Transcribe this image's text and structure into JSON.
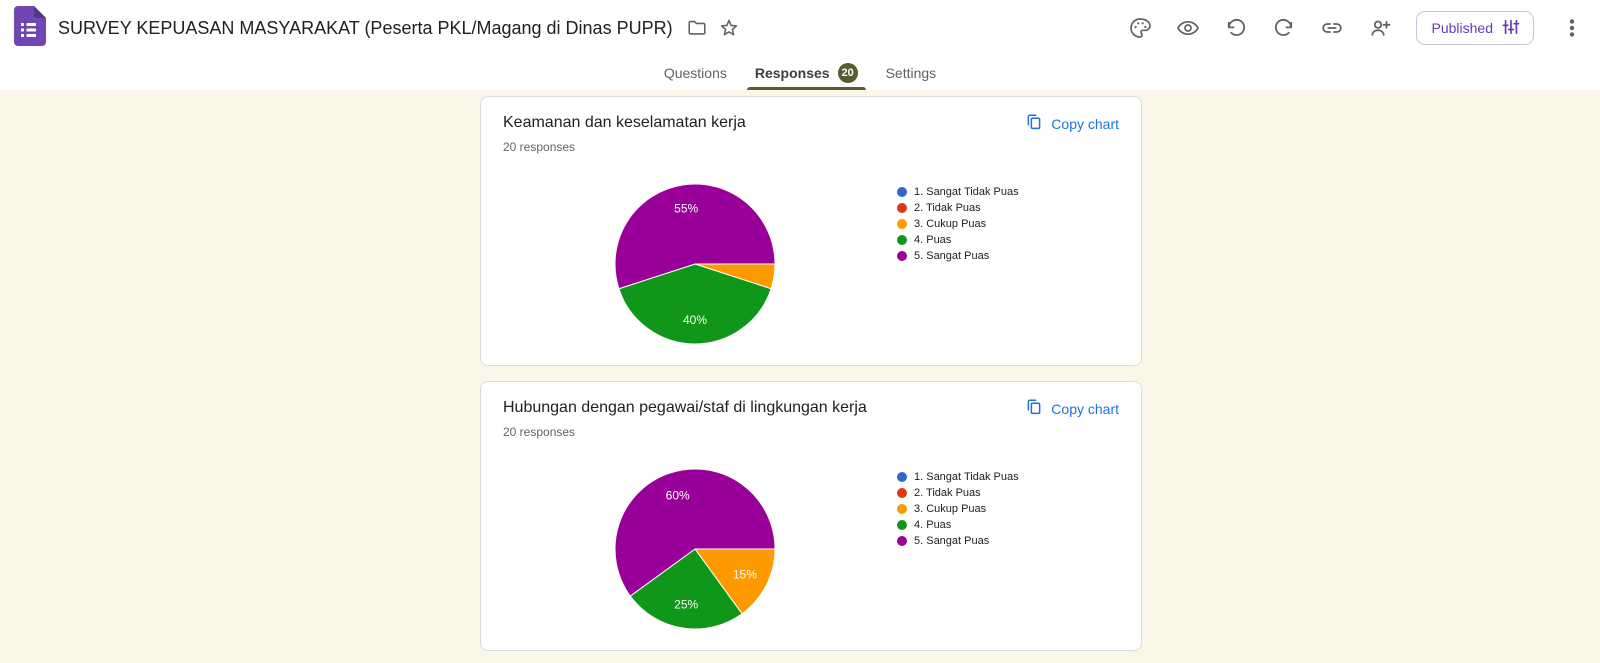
{
  "app": {
    "title": "SURVEY KEPUASAN MASYARAKAT (Peserta PKL/Magang di Dinas PUPR)",
    "published_label": "Published",
    "toolbar_icon_names": [
      "customize-theme-palette-icon",
      "preview-eye-icon",
      "undo-icon",
      "redo-icon",
      "copy-link-icon",
      "add-collaborator-icon",
      "tune-settings-icon",
      "more-options-icon"
    ],
    "title_icon_names": [
      "forms-logo-icon",
      "move-folder-icon",
      "star-icon"
    ]
  },
  "tabs": {
    "questions": "Questions",
    "responses": "Responses",
    "responses_badge": "20",
    "settings": "Settings",
    "active": "Responses"
  },
  "colors": {
    "accent_olive": "#595c31",
    "page_background": "#faf7e8",
    "link_blue": "#1a73e8",
    "publish_purple": "#673ab7",
    "forms_purple": "#7046b2"
  },
  "chart_data": [
    {
      "type": "pie",
      "title": "Keamanan dan keselamatan kerja",
      "responses_label": "20 responses",
      "copy_chart_label": "Copy chart",
      "categories": [
        "1. Sangat Tidak Puas",
        "2. Tidak Puas",
        "3. Cukup Puas",
        "4. Puas",
        "5. Sangat Puas"
      ],
      "values_pct": [
        0,
        0,
        5,
        40,
        55
      ],
      "colors": [
        "#3366cc",
        "#dc3912",
        "#ff9900",
        "#109618",
        "#990099"
      ],
      "visible_slice_labels": [
        "55%",
        "40%"
      ],
      "legend_position": "right",
      "start_angle_deg": 90,
      "min_label_pct": 10
    },
    {
      "type": "pie",
      "title": "Hubungan dengan pegawai/staf di lingkungan kerja",
      "responses_label": "20 responses",
      "copy_chart_label": "Copy chart",
      "categories": [
        "1. Sangat Tidak Puas",
        "2. Tidak Puas",
        "3. Cukup Puas",
        "4. Puas",
        "5. Sangat Puas"
      ],
      "values_pct": [
        0,
        0,
        15,
        25,
        60
      ],
      "colors": [
        "#3366cc",
        "#dc3912",
        "#ff9900",
        "#109618",
        "#990099"
      ],
      "visible_slice_labels": [
        "60%",
        "25%",
        "15%"
      ],
      "legend_position": "right",
      "start_angle_deg": 90,
      "min_label_pct": 10
    }
  ]
}
